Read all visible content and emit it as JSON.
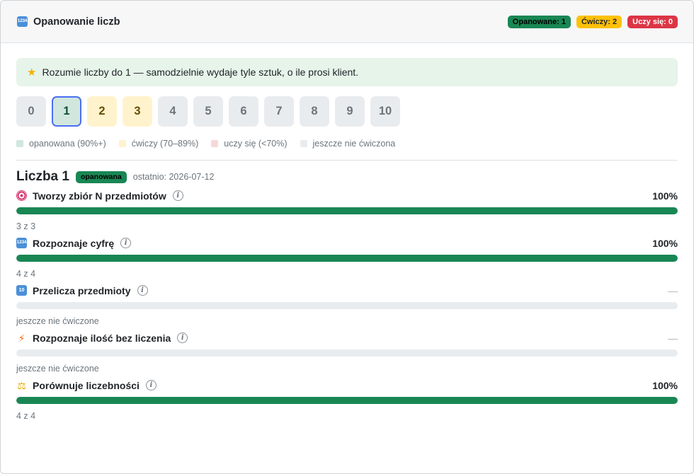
{
  "header": {
    "title": "Opanowanie liczb",
    "badges": {
      "mastered": "Opanowane: 1",
      "practicing": "Ćwiczy: 2",
      "learning": "Uczy się: 0"
    }
  },
  "goal": "Rozumie liczby do 1 — samodzielnie wydaje tyle sztuk, o ile prosi klient.",
  "numbers": [
    "0",
    "1",
    "2",
    "3",
    "4",
    "5",
    "6",
    "7",
    "8",
    "9",
    "10"
  ],
  "legend": {
    "mastered": "opanowana (90%+)",
    "practicing": "ćwiczy (70–89%)",
    "learning": "uczy się (<70%)",
    "untrained": "jeszcze nie ćwiczona"
  },
  "selected": {
    "title": "Liczba 1",
    "status": "opanowana",
    "last": "ostatnio: 2026-07-12"
  },
  "skills": [
    {
      "name": "Tworzy zbiór N przedmiotów",
      "percent": "100%",
      "progress": 1.0,
      "count": "3 z 3",
      "icon": "target-icon"
    },
    {
      "name": "Rozpoznaje cyfrę",
      "percent": "100%",
      "progress": 1.0,
      "count": "4 z 4",
      "icon": "numbers-icon"
    },
    {
      "name": "Przelicza przedmioty",
      "percent": "—",
      "progress": 0,
      "count": "jeszcze nie ćwiczone",
      "icon": "keycap-ten-icon"
    },
    {
      "name": "Rozpoznaje ilość bez liczenia",
      "percent": "—",
      "progress": 0,
      "count": "jeszcze nie ćwiczone",
      "icon": "lightning-icon"
    },
    {
      "name": "Porównuje liczebności",
      "percent": "100%",
      "progress": 1.0,
      "count": "4 z 4",
      "icon": "scales-icon"
    }
  ],
  "colors": {
    "mastered": "#d1e7dd",
    "practicing": "#fff3cd",
    "learning": "#f8d7da",
    "untrained": "#e9ecef",
    "bar_fill": "#198754"
  }
}
